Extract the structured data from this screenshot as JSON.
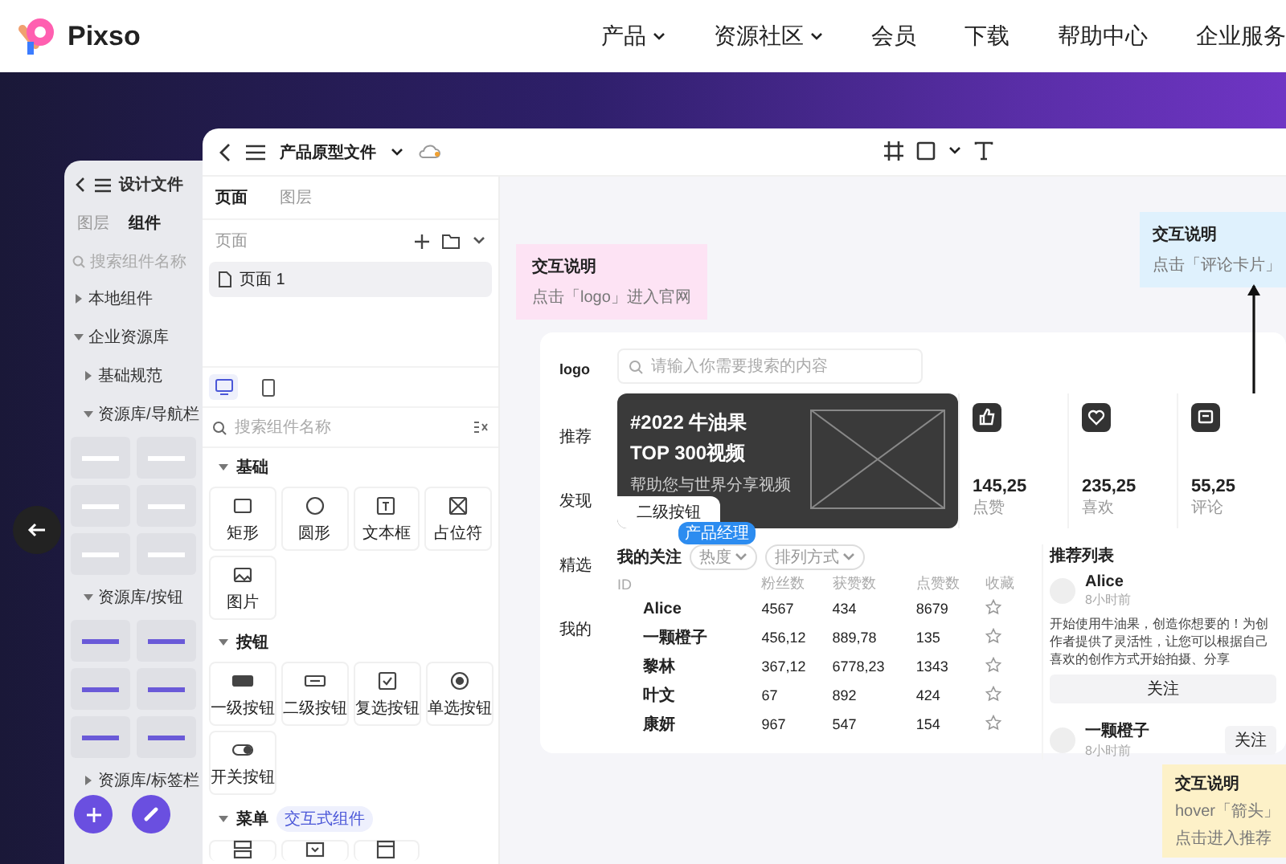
{
  "nav": {
    "brand": "Pixso",
    "items": [
      {
        "label": "产品",
        "dropdown": true
      },
      {
        "label": "资源社区",
        "dropdown": true
      },
      {
        "label": "会员",
        "dropdown": false
      },
      {
        "label": "下载",
        "dropdown": false
      },
      {
        "label": "帮助中心",
        "dropdown": false
      },
      {
        "label": "企业服务",
        "dropdown": false
      }
    ]
  },
  "back_panel": {
    "title": "设计文件",
    "tabs": [
      {
        "label": "图层",
        "selected": false
      },
      {
        "label": "组件",
        "selected": true
      }
    ],
    "search": {
      "placeholder": "搜索组件名称"
    },
    "tree": [
      {
        "label": "本地组件",
        "expanded": false
      },
      {
        "label": "企业资源库",
        "expanded": true,
        "children": [
          {
            "label": "基础规范",
            "expanded": false
          },
          {
            "label": "资源库/导航栏",
            "expanded": true,
            "kind": "navbar"
          },
          {
            "label": "资源库/按钮",
            "expanded": true,
            "kind": "button"
          },
          {
            "label": "资源库/标签栏",
            "expanded": false
          }
        ]
      }
    ]
  },
  "file": {
    "title": "产品原型文件"
  },
  "left_panel": {
    "tabs": [
      {
        "label": "页面",
        "selected": true
      },
      {
        "label": "图层",
        "selected": false
      }
    ],
    "pages_label": "页面",
    "pages": [
      {
        "label": "页面 1",
        "selected": true
      }
    ],
    "devices": [
      {
        "kind": "desktop",
        "selected": true
      },
      {
        "kind": "mobile",
        "selected": false
      }
    ],
    "search": {
      "placeholder": "搜索组件名称"
    },
    "sections": [
      {
        "label": "基础",
        "expanded": true,
        "items": [
          {
            "kind": "rectangle",
            "label": "矩形"
          },
          {
            "kind": "ellipse",
            "label": "圆形"
          },
          {
            "kind": "textbox",
            "label": "文本框"
          },
          {
            "kind": "placeholder",
            "label": "占位符"
          },
          {
            "kind": "image",
            "label": "图片"
          }
        ]
      },
      {
        "label": "按钮",
        "expanded": true,
        "items": [
          {
            "kind": "primary",
            "label": "一级按钮"
          },
          {
            "kind": "secondary",
            "label": "二级按钮"
          },
          {
            "kind": "checkbox",
            "label": "复选按钮"
          },
          {
            "kind": "radio",
            "label": "单选按钮"
          },
          {
            "kind": "switch",
            "label": "开关按钮"
          }
        ]
      },
      {
        "label": "菜单",
        "expanded": true,
        "badge": "交互式组件",
        "items": [
          {
            "kind": "menu"
          },
          {
            "kind": "dropdown"
          },
          {
            "kind": "window"
          }
        ]
      }
    ]
  },
  "canvas": {
    "notes": [
      {
        "title": "交互说明",
        "lines": [
          "点击「logo」进入官网"
        ],
        "color": "#fde3f4"
      },
      {
        "title": "交互说明",
        "lines": [
          "点击「评论卡片」"
        ],
        "color": "#dff1fd"
      },
      {
        "title": "交互说明",
        "lines": [
          "hover「箭头」",
          "点击进入推荐"
        ],
        "color": "#fdf1c8"
      }
    ],
    "mockup": {
      "logo": "logo",
      "menu": [
        "推荐",
        "发现",
        "精选",
        "我的"
      ],
      "search": {
        "placeholder": "请输入你需要搜索的内容"
      },
      "banner": {
        "title": [
          "#2022 牛油果",
          "TOP 300视频"
        ],
        "subtitle": "帮助您与世界分享视频",
        "button": "二级按钮",
        "tag": "产品经理"
      },
      "stats": [
        {
          "kind": "like",
          "value": "145,25",
          "label": "点赞"
        },
        {
          "kind": "heart",
          "value": "235,25",
          "label": "喜欢"
        },
        {
          "kind": "comment",
          "value": "55,25",
          "label": "评论"
        }
      ],
      "follow": {
        "title": "我的关注",
        "filters": [
          "热度",
          "排列方式"
        ],
        "columns": [
          "ID",
          "粉丝数",
          "获赞数",
          "点赞数",
          "收藏"
        ],
        "rows": [
          {
            "name": "Alice",
            "fans": "4567",
            "received": "434",
            "likes": "8679",
            "starred": false
          },
          {
            "name": "一颗橙子",
            "fans": "456,12",
            "received": "889,78",
            "likes": "135",
            "starred": false
          },
          {
            "name": "黎林",
            "fans": "367,12",
            "received": "6778,23",
            "likes": "1343",
            "starred": false
          },
          {
            "name": "叶文",
            "fans": "67",
            "received": "892",
            "likes": "424",
            "starred": false
          },
          {
            "name": "康妍",
            "fans": "967",
            "received": "547",
            "likes": "154",
            "starred": false
          }
        ]
      },
      "recommend": {
        "title": "推荐列表",
        "items": [
          {
            "kind": "expanded",
            "name": "Alice",
            "time": "8小时前",
            "text": "开始使用牛油果，创造你想要的！为创作者提供了灵活性，让您可以根据自己喜欢的创作方式开始拍摄、分享",
            "button": "关注"
          },
          {
            "kind": "compact",
            "name": "一颗橙子",
            "time": "8小时前",
            "button": "关注"
          }
        ]
      }
    }
  }
}
